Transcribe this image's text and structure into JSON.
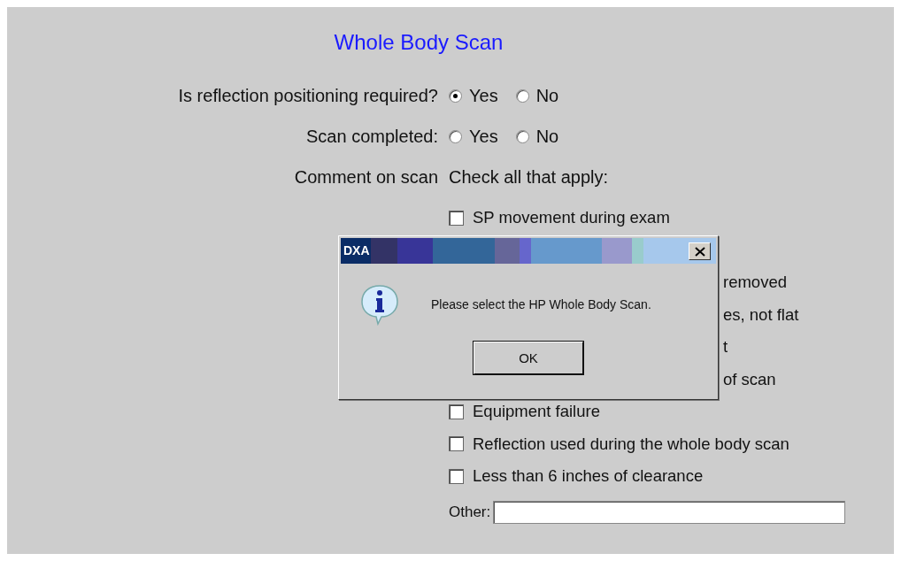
{
  "title": "Whole Body Scan",
  "questions": [
    {
      "label": "Is reflection positioning required?",
      "options": [
        {
          "label": "Yes",
          "selected": true
        },
        {
          "label": "No",
          "selected": false
        }
      ]
    },
    {
      "label": "Scan completed:",
      "options": [
        {
          "label": "Yes",
          "selected": false
        },
        {
          "label": "No",
          "selected": false
        }
      ]
    }
  ],
  "comment": {
    "label": "Comment on scan",
    "instruction": "Check all that apply:",
    "items": [
      {
        "kind": "checkbox",
        "label": "SP movement during exam",
        "checked": false
      },
      {
        "kind": "covered"
      },
      {
        "kind": "fragment",
        "label": "removed"
      },
      {
        "kind": "fragment",
        "label": "es, not flat"
      },
      {
        "kind": "fragment",
        "label": "t"
      },
      {
        "kind": "fragment",
        "label": "of scan"
      },
      {
        "kind": "checkbox",
        "label": "Equipment failure",
        "checked": false
      },
      {
        "kind": "checkbox",
        "label": "Reflection used during the whole body scan",
        "checked": false
      },
      {
        "kind": "checkbox",
        "label": "Less than 6 inches of clearance",
        "checked": false
      }
    ]
  },
  "other": {
    "label": "Other:"
  },
  "dialog": {
    "title": "DXA",
    "message": "Please select the HP Whole Body Scan.",
    "buttons": [
      "OK"
    ]
  }
}
